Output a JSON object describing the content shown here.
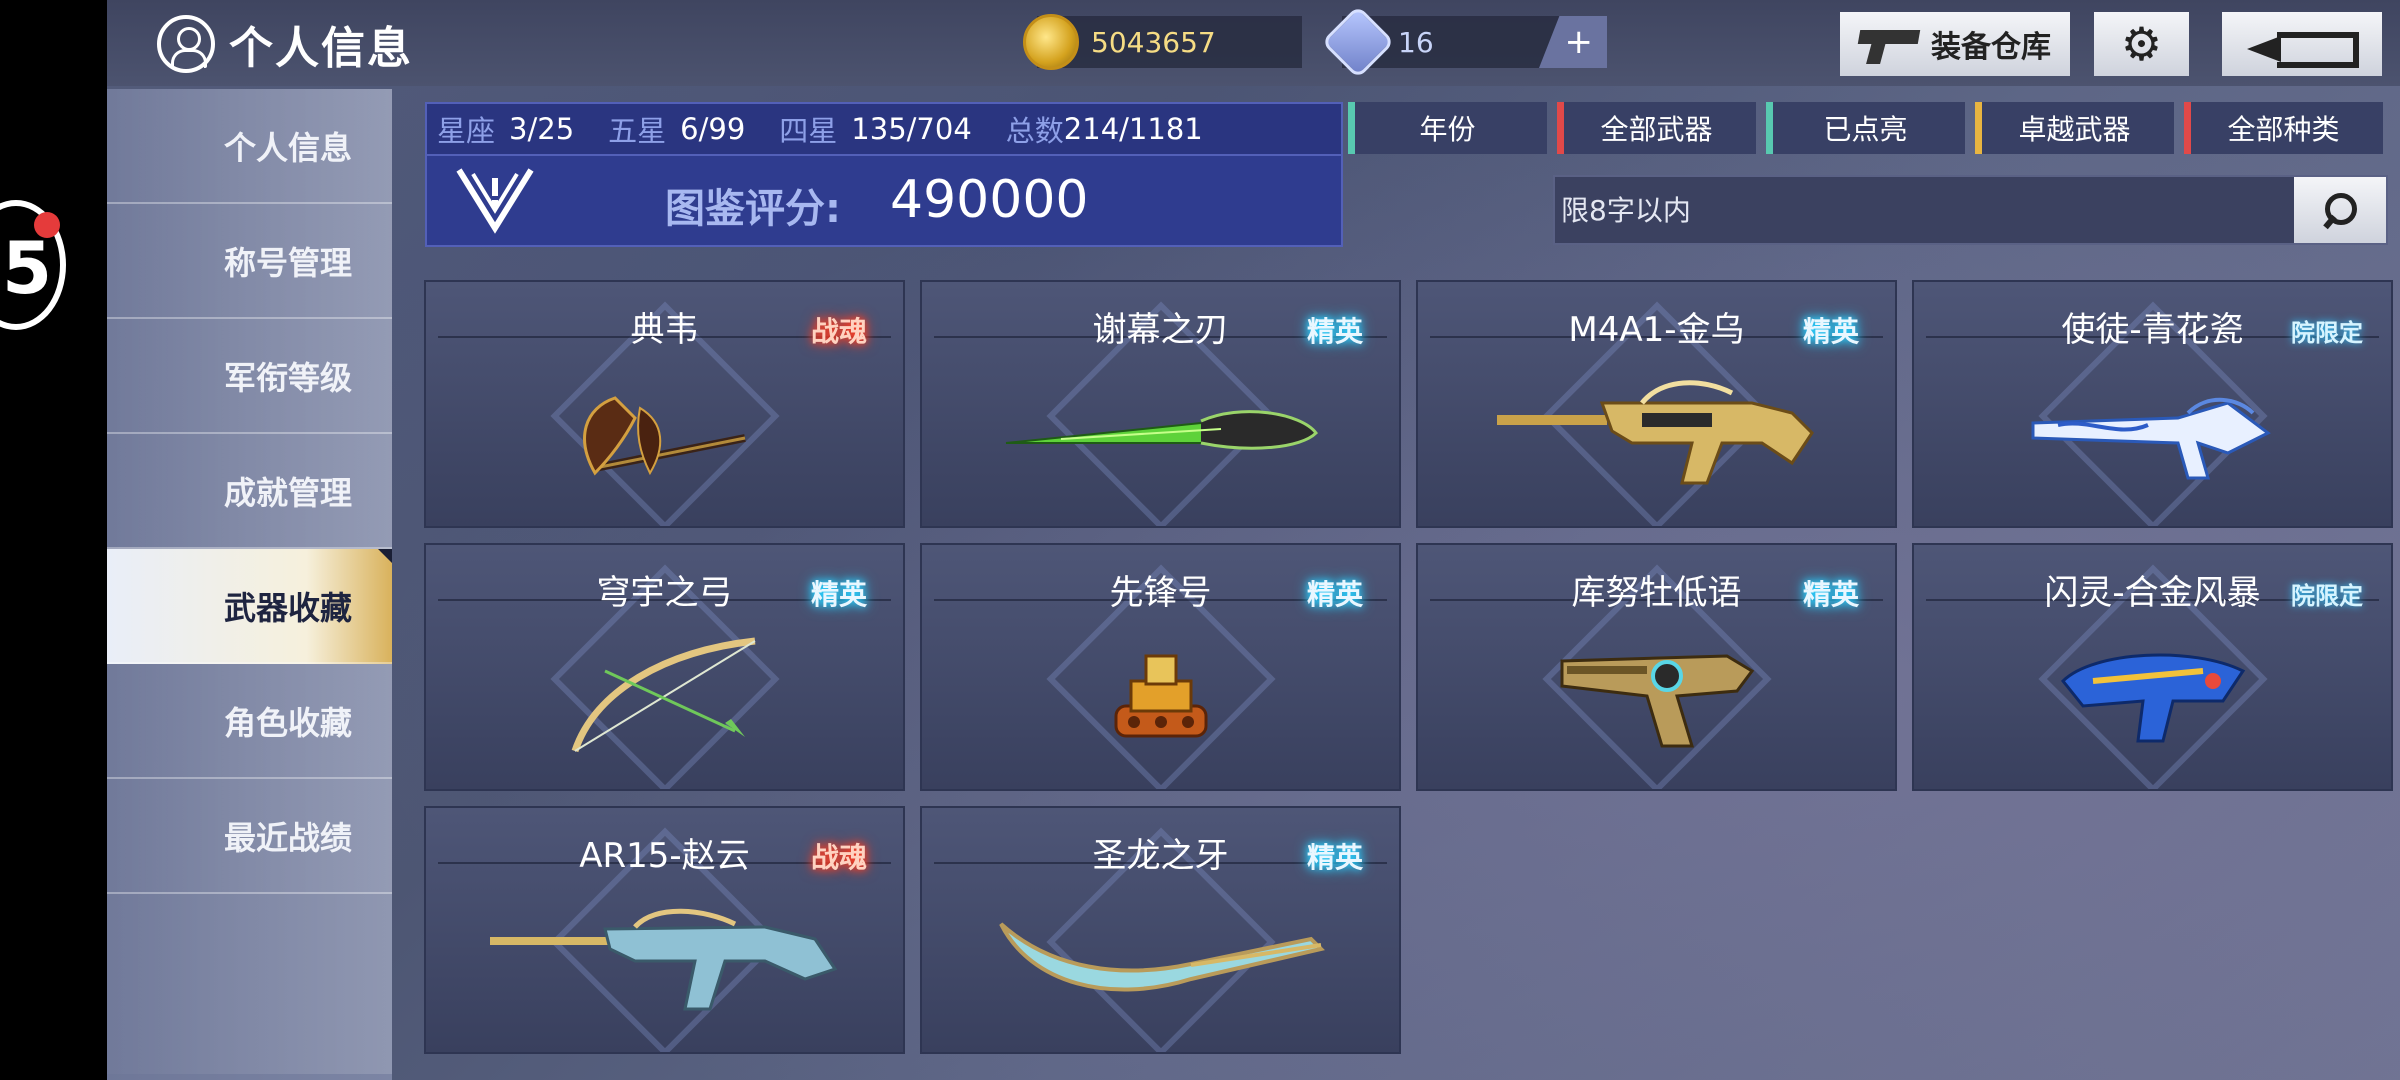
{
  "header": {
    "title": "个人信息",
    "gold": "5043657",
    "gems": "16",
    "gem_plus": "+",
    "warehouse_label": "装备仓库",
    "float_badge_num": "5"
  },
  "sidebar": {
    "items": [
      {
        "label": "个人信息"
      },
      {
        "label": "称号管理"
      },
      {
        "label": "军衔等级"
      },
      {
        "label": "成就管理"
      },
      {
        "label": "武器收藏",
        "active": true
      },
      {
        "label": "角色收藏"
      },
      {
        "label": "最近战绩"
      }
    ]
  },
  "stats": {
    "constellation_label": "星座",
    "constellation": "3/25",
    "five_star_label": "五星",
    "five_star": "6/99",
    "four_star_label": "四星",
    "four_star": "135/704",
    "total_label": "总数",
    "total": "214/1181",
    "score_label": "图鉴评分:",
    "score_value": "490000"
  },
  "filters": [
    {
      "label": "年份",
      "color": "#58c9b0"
    },
    {
      "label": "全部武器",
      "color": "#e14949"
    },
    {
      "label": "已点亮",
      "color": "#58c9b0"
    },
    {
      "label": "卓越武器",
      "color": "#e8b541"
    },
    {
      "label": "全部种类",
      "color": "#e14949"
    }
  ],
  "search": {
    "placeholder": "限8字以内"
  },
  "weapons": [
    {
      "name": "典韦",
      "tag": "战魂",
      "tag_type": "war",
      "icon": "axe-weapon"
    },
    {
      "name": "谢幕之刃",
      "tag": "精英",
      "tag_type": "elite",
      "icon": "blade-weapon"
    },
    {
      "name": "M4A1-金乌",
      "tag": "精英",
      "tag_type": "elite",
      "icon": "rifle-weapon"
    },
    {
      "name": "使徒-青花瓷",
      "tag": "院限定",
      "tag_type": "limited",
      "icon": "cannon-weapon"
    },
    {
      "name": "穹宇之弓",
      "tag": "精英",
      "tag_type": "elite",
      "icon": "bow-weapon"
    },
    {
      "name": "先锋号",
      "tag": "精英",
      "tag_type": "elite",
      "icon": "tank-weapon"
    },
    {
      "name": "库努牡低语",
      "tag": "精英",
      "tag_type": "elite",
      "icon": "revolver-weapon"
    },
    {
      "name": "闪灵-合金风暴",
      "tag": "院限定",
      "tag_type": "limited",
      "icon": "blaster-weapon"
    },
    {
      "name": "AR15-赵云",
      "tag": "战魂",
      "tag_type": "war",
      "icon": "rifle-weapon"
    },
    {
      "name": "圣龙之牙",
      "tag": "精英",
      "tag_type": "elite",
      "icon": "sickle-weapon"
    }
  ],
  "colors": {
    "stats_bg": "#2f3c8f",
    "accent_gold": "#d9b25c",
    "elite_glow": "#29d0ff",
    "war_glow": "#ff3d20"
  }
}
